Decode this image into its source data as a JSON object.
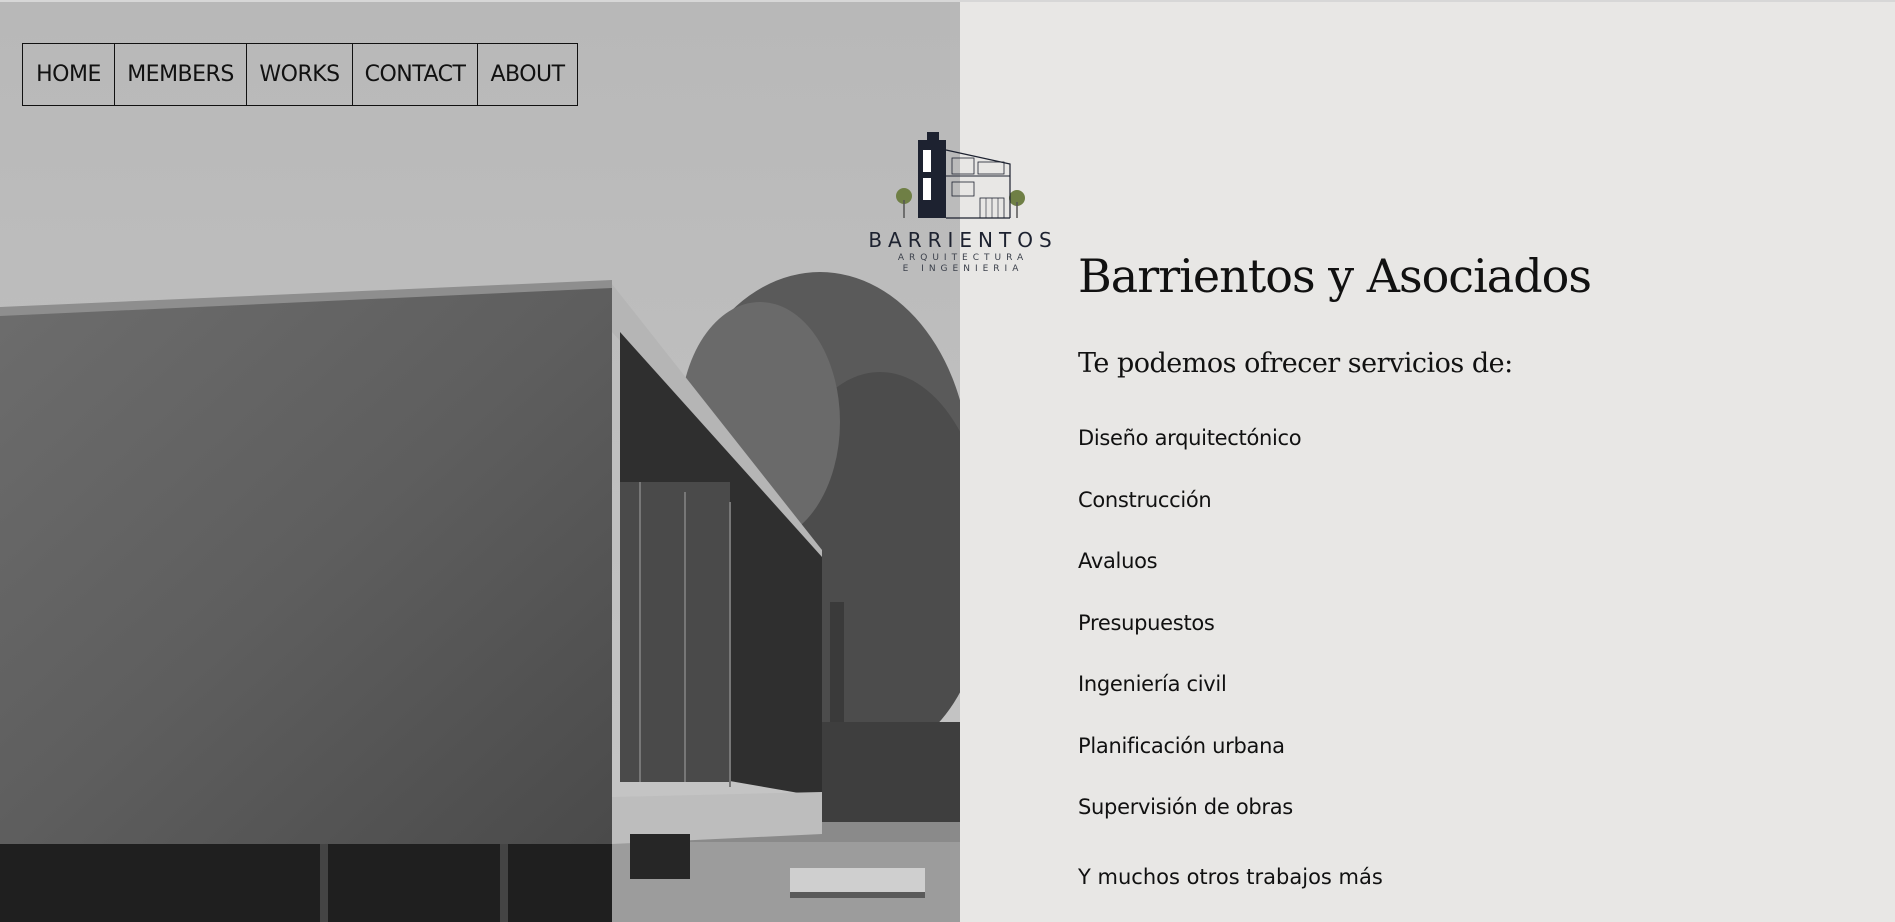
{
  "nav": {
    "items": [
      {
        "label": "HOME"
      },
      {
        "label": "MEMBERS"
      },
      {
        "label": "WORKS"
      },
      {
        "label": "CONTACT"
      },
      {
        "label": "ABOUT"
      }
    ]
  },
  "logo": {
    "name": "BARRIENTOS",
    "sub1": "ARQUITECTURA",
    "sub2": "E INGENIERIA"
  },
  "main": {
    "title": "Barrientos y Asociados",
    "subtitle": "Te podemos ofrecer servicios de:",
    "services": [
      "Diseño arquitectónico",
      "Construcción",
      "Avaluos",
      "Presupuestos",
      "Ingeniería civil",
      "Planificación urbana",
      "Supervisión de obras"
    ],
    "more": "Y muchos otros trabajos más"
  },
  "colors": {
    "background": "#e8e7e5",
    "logo_navy": "#1d2230",
    "logo_green": "#6f7f45"
  }
}
